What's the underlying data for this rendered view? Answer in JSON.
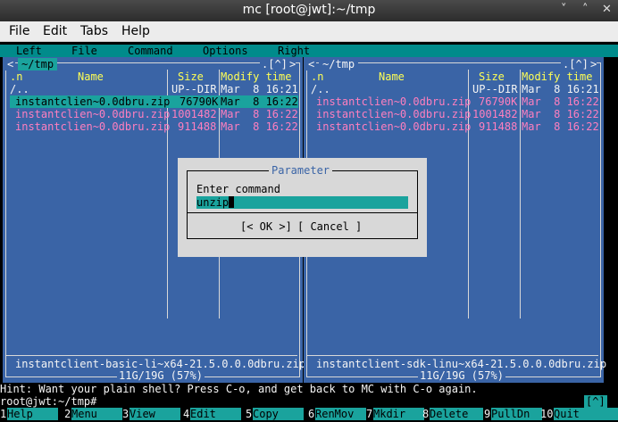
{
  "window": {
    "title": "mc [root@jwt]:~/tmp",
    "minimize": "˅",
    "maximize": "˄",
    "close": "✕"
  },
  "menubar": [
    "File",
    "Edit",
    "Tabs",
    "Help"
  ],
  "mc_menu": [
    "Left",
    "File",
    "Command",
    "Options",
    "Right"
  ],
  "left_panel": {
    "path": "~/tmp",
    "corner": ".[^]",
    "columns": {
      "n": ".n",
      "name": "Name",
      "size": "Size",
      "modify": "Modify time"
    },
    "rows": [
      {
        "name": "/..",
        "size": "UP--DIR",
        "date": "Mar  8 16:21",
        "type": "dir"
      },
      {
        "name": "instantclien~0.0dbru.zip",
        "size": "76790K",
        "date": "Mar  8 16:22",
        "type": "selected"
      },
      {
        "name": "instantclien~0.0dbru.zip",
        "size": "1001482",
        "date": "Mar  8 16:22",
        "type": "archive"
      },
      {
        "name": "instantclien~0.0dbru.zip",
        "size": "911488",
        "date": "Mar  8 16:22",
        "type": "archive"
      }
    ],
    "status": "instantclient-basic-li~x64-21.5.0.0.0dbru.zip",
    "disk": "11G/19G (57%)"
  },
  "right_panel": {
    "path": "~/tmp",
    "corner": ".[^]",
    "columns": {
      "n": ".n",
      "name": "Name",
      "size": "Size",
      "modify": "Modify time"
    },
    "rows": [
      {
        "name": "/..",
        "size": "UP--DIR",
        "date": "Mar  8 16:21",
        "type": "dir"
      },
      {
        "name": "instantclien~0.0dbru.zip",
        "size": "76790K",
        "date": "Mar  8 16:22",
        "type": "archive"
      },
      {
        "name": "instantclien~0.0dbru.zip",
        "size": "1001482",
        "date": "Mar  8 16:22",
        "type": "archive"
      },
      {
        "name": "instantclien~0.0dbru.zip",
        "size": "911488",
        "date": "Mar  8 16:22",
        "type": "archive"
      }
    ],
    "status": "instantclient-sdk-linu~x64-21.5.0.0.0dbru.zip",
    "disk": "11G/19G (57%)"
  },
  "dialog": {
    "title": "Parameter",
    "label": "Enter command",
    "value": "unzip",
    "ok": "[< OK >]",
    "cancel": "[ Cancel ]"
  },
  "hint": "Hint: Want your plain shell? Press C-o, and get back to MC with C-o again.",
  "prompt": "root@jwt:~/tmp#",
  "prompt_corner": "[^]",
  "fkeys": [
    {
      "n": "1",
      "l": "Help"
    },
    {
      "n": "2",
      "l": "Menu"
    },
    {
      "n": "3",
      "l": "View"
    },
    {
      "n": "4",
      "l": "Edit"
    },
    {
      "n": "5",
      "l": "Copy"
    },
    {
      "n": "6",
      "l": "RenMov"
    },
    {
      "n": "7",
      "l": "Mkdir"
    },
    {
      "n": "8",
      "l": "Delete"
    },
    {
      "n": "9",
      "l": "PullDn"
    },
    {
      "n": "10",
      "l": "Quit"
    }
  ],
  "colors": {
    "panel": "#3a64a6",
    "accent": "#1aa39d",
    "header": "#ffff55",
    "archive": "#ff7fbf"
  }
}
